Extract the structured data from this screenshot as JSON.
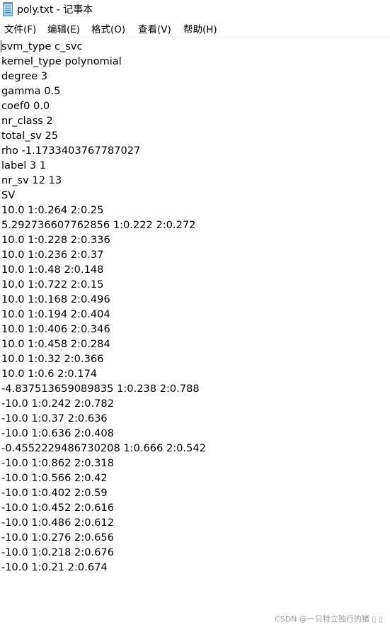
{
  "window": {
    "title": "poly.txt - 记事本"
  },
  "menu": [
    {
      "label": "文件(F)"
    },
    {
      "label": "编辑(E)"
    },
    {
      "label": "格式(O)"
    },
    {
      "label": "查看(V)"
    },
    {
      "label": "帮助(H)"
    }
  ],
  "lines": [
    "svm_type c_svc",
    "kernel_type polynomial",
    "degree 3",
    "gamma 0.5",
    "coef0 0.0",
    "nr_class 2",
    "total_sv 25",
    "rho -1.1733403767787027",
    "label 3 1",
    "nr_sv 12 13",
    "SV",
    "10.0 1:0.264 2:0.25",
    "5.292736607762856 1:0.222 2:0.272",
    "10.0 1:0.228 2:0.336",
    "10.0 1:0.236 2:0.37",
    "10.0 1:0.48 2:0.148",
    "10.0 1:0.722 2:0.15",
    "10.0 1:0.168 2:0.496",
    "10.0 1:0.194 2:0.404",
    "10.0 1:0.406 2:0.346",
    "10.0 1:0.458 2:0.284",
    "10.0 1:0.32 2:0.366",
    "10.0 1:0.6 2:0.174",
    "-4.837513659089835 1:0.238 2:0.788",
    "-10.0 1:0.242 2:0.782",
    "-10.0 1:0.37 2:0.636",
    "-10.0 1:0.636 2:0.408",
    "-0.4552229486730208 1:0.666 2:0.542",
    "-10.0 1:0.862 2:0.318",
    "-10.0 1:0.566 2:0.42",
    "-10.0 1:0.402 2:0.59",
    "-10.0 1:0.452 2:0.616",
    "-10.0 1:0.486 2:0.612",
    "-10.0 1:0.276 2:0.656",
    "-10.0 1:0.218 2:0.676",
    "-10.0 1:0.21 2:0.674"
  ],
  "watermark": "CSDN @一只特立独行的猪 ▯ ▯"
}
